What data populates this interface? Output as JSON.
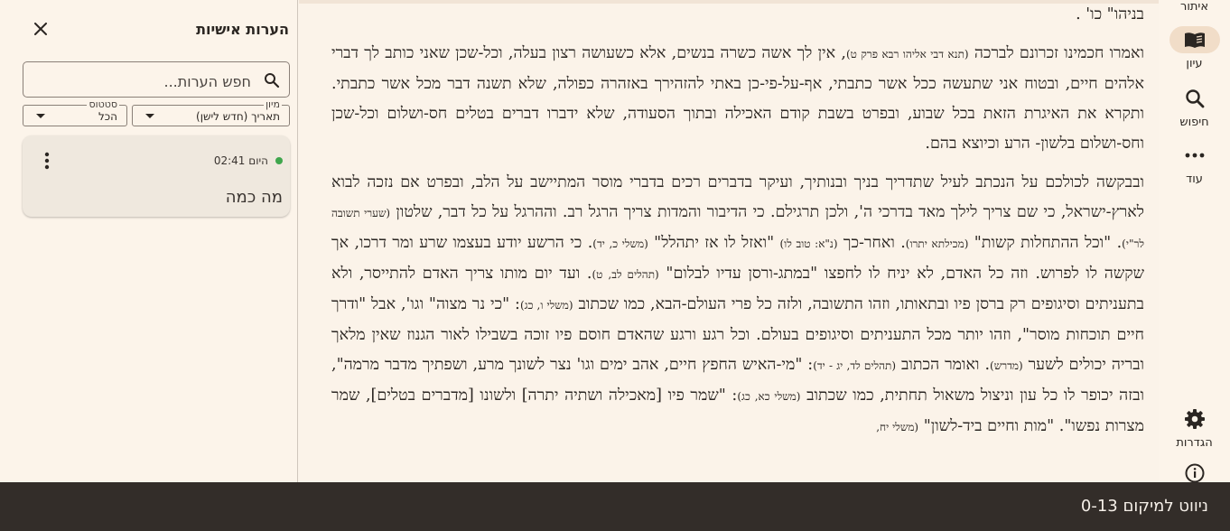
{
  "notes_panel": {
    "title": "הערות אישיות",
    "close_icon": "close-icon",
    "search": {
      "placeholder": "חפש הערות...",
      "value": "",
      "icon": "search-icon"
    },
    "sort": {
      "legend": "מיון",
      "value": "תאריך (חדש לישן)"
    },
    "status": {
      "legend": "סטטוס",
      "value": "הכל"
    },
    "notes": [
      {
        "time": "היום 02:41",
        "text": "מה כמה",
        "status_color": "#3fa64d"
      }
    ]
  },
  "content": {
    "paragraphs": [
      [
        {
          "t": "בניהו\" כו' ."
        }
      ],
      [
        {
          "t": "ואמרו חכמינו זכרונם לברכה "
        },
        {
          "t": "(תנא דבי אליהו רבא פרק ט)",
          "src": true
        },
        {
          "t": ", אין לך אשה כשרה בנשים, אלא כשעושה רצון בעלה, וכל-שכן שאני כותב לך דברי אלהים חיים, ובטוח אני שתעשה ככל אשר כתבתי, אף-על-פי-כן באתי להזהירך באזהרה כפולה, שלא תשנה דבר מכל אשר כתבתי. ותקרא את האיגרת הזאת בכל שבוע, ובפרט בשבת קודם האכילה ובתוך הסעודה, שלא ידברו דברים בטלים חס-ושלום וכל-שכן וחס-ושלום בלשון- הרע וכיוצא בהם."
        }
      ],
      [
        {
          "t": "ובבקשה לכולכם על הנכתב לעיל שתדריך בניך ובנותיך, ועיקר בדברים רכים בדברי מוסר המתיישב על הלב, ובפרט אם נזכה לבוא לארץ-ישראל, כי שם צריך לילך מאד בדרכי ה', ולכן תרגילם. כי הדיבור והמדות צריך הרגל רב. וההרגל על כל דבר, שלטון "
        },
        {
          "t": "(שערי תשובה לר\"י)",
          "src": true
        },
        {
          "t": ". \"וכל ההתחלות קשות\" "
        },
        {
          "t": "(מכילתא יתרו)",
          "src": true
        },
        {
          "t": ". ואחר-כך "
        },
        {
          "t": "(נ\"א: טוב לו)",
          "src": true
        },
        {
          "t": " \"ואזל לו אז יתהלל\" "
        },
        {
          "t": "(משלי כ, יד)",
          "src": true
        },
        {
          "t": ". כי הרשע יודע בעצמו שרע ומר דרכו, אך שקשה לו לפרוש. וזה כל האדם, לא יניח לו לחפצו \"במתג-ורסן עדיו לבלום\" "
        },
        {
          "t": "(תהלים לב, ט)",
          "src": true
        },
        {
          "t": ". ועד יום מותו צריך האדם להתייסר, ולא בתעניתים וסיגופים רק ברסן פיו ובתאותו, וזהו התשובה, ולזה כל פרי העולם-הבא, כמו שכתוב "
        },
        {
          "t": "(משלי ו, כג)",
          "src": true
        },
        {
          "t": ": \"כי נר מצוה\" וגו', אבל \"ודרך חיים תוכחות מוסר\", וזהו יותר מכל התעניתים וסיגופים בעולם. וכל רגע ורגע שהאדם חוסם פיו זוכה בשבילו לאור הגנוז שאין מלאך ובריה יכולים לשער "
        },
        {
          "t": "(מדרש)",
          "src": true
        },
        {
          "t": ". ואומר הכתוב "
        },
        {
          "t": "(תהלים לד, יג - יד)",
          "src": true
        },
        {
          "t": ": \"מי-האיש החפץ חיים, אהב ימים וגו' נצר לשונך מרע, ושפתיך מדבר מרמה\", ובזה יכופר לו כל עון וניצול משאול תחתית, כמו שכתוב "
        },
        {
          "t": "(משלי כא, כג)",
          "src": true
        },
        {
          "t": ": \"שמר פיו [מאכילה ושתיה יתרה] ולשונו [מדברים בטלים], שמר מצרות נפשו\". \"מות וחיים ביד-לשון\" "
        },
        {
          "t": "(משלי יח,",
          "src": true
        }
      ]
    ]
  },
  "rail": {
    "items": [
      {
        "key": "locate",
        "label": "איתור",
        "icon": ""
      },
      {
        "key": "read",
        "label": "עיון",
        "icon": "book-open-icon"
      },
      {
        "key": "search",
        "label": "חיפוש",
        "icon": "search-icon"
      },
      {
        "key": "more",
        "label": "עוד",
        "icon": "more-horizontal-icon"
      },
      {
        "key": "settings",
        "label": "הגדרות",
        "icon": "gear-icon"
      },
      {
        "key": "about",
        "label": "",
        "icon": "info-icon"
      }
    ]
  },
  "bottom_bar": {
    "text": "ניווט למיקום 0-13"
  },
  "colors": {
    "background": "#fbf3e9",
    "accent_pill": "#f1ddc8",
    "bottom_bar": "#332d29",
    "card": "#efe8de"
  }
}
